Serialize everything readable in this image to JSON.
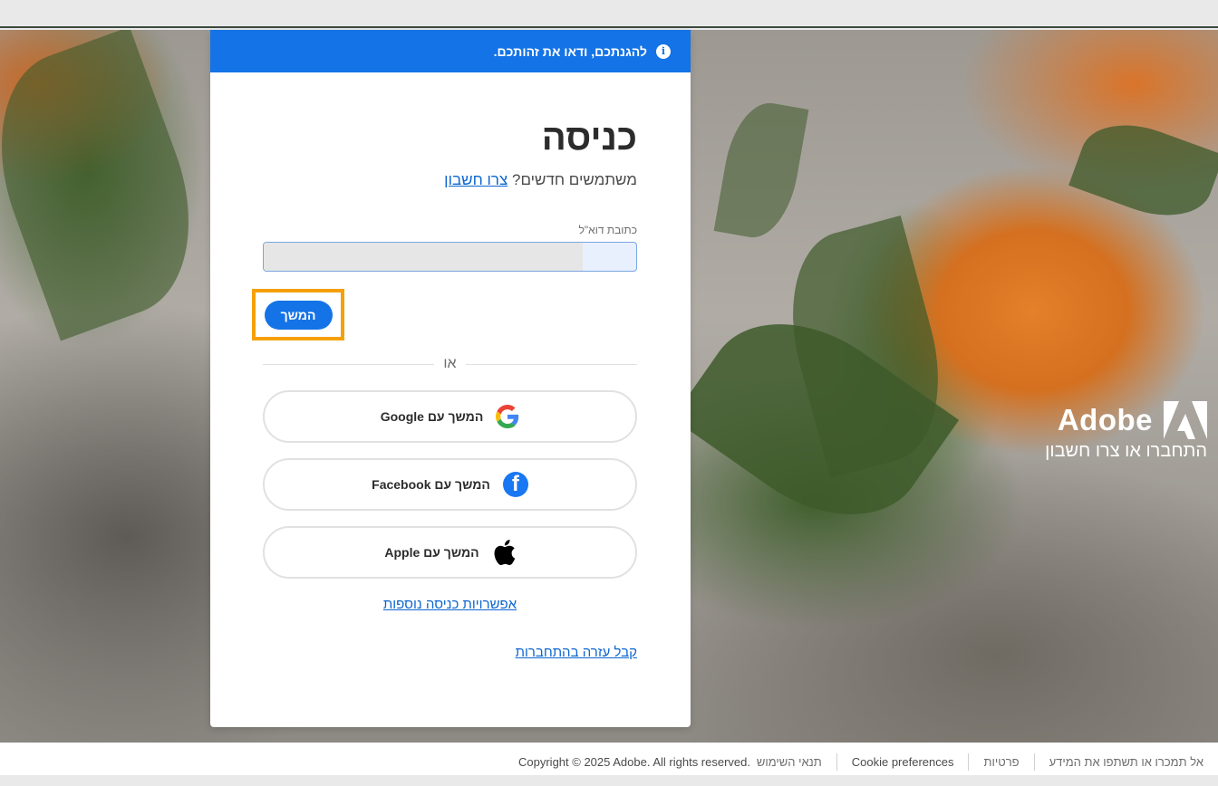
{
  "banner": {
    "text": "להגנתכם, ודאו את זהותכם."
  },
  "signin": {
    "title": "כניסה",
    "new_users_text": "משתמשים חדשים?",
    "create_account_link": "צרו חשבון",
    "email_label": "כתובת דוא\"ל",
    "email_value": "",
    "continue_button": "המשך",
    "or_text": "או"
  },
  "social": {
    "google": {
      "prefix": "המשך עם",
      "provider": "Google",
      "icon": "google-icon"
    },
    "facebook": {
      "prefix": "המשך עם",
      "provider": "Facebook",
      "icon": "facebook-icon"
    },
    "apple": {
      "prefix": "המשך עם",
      "provider": "Apple",
      "icon": "apple-icon"
    }
  },
  "links": {
    "more_options": "אפשרויות כניסה נוספות",
    "help": "קבל עזרה בהתחברות"
  },
  "brand": {
    "name": "Adobe",
    "subtitle": "התחברו או צרו חשבון"
  },
  "footer": {
    "copyright": "Copyright © 2025 Adobe. All rights reserved.",
    "terms": "תנאי השימוש",
    "cookies": "Cookie preferences",
    "privacy": "פרטיות",
    "do_not_sell": "אל תמכרו או תשתפו את המידע"
  },
  "colors": {
    "accent": "#1473e6",
    "highlight": "#f5a00a",
    "link": "#0d66d0"
  }
}
